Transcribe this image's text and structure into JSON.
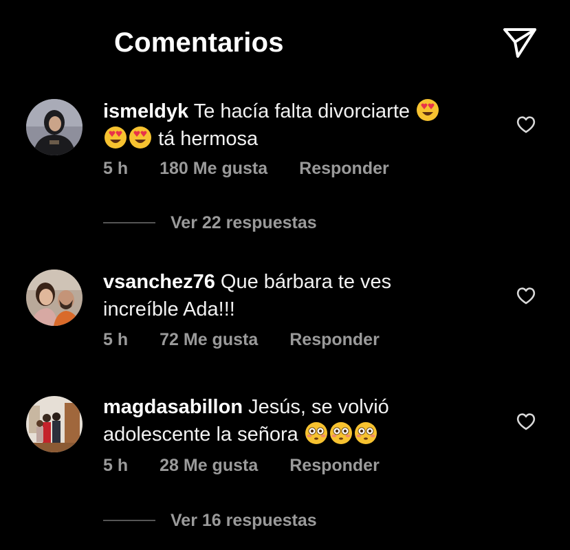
{
  "header": {
    "title": "Comentarios",
    "share_icon": "paper-plane-icon"
  },
  "comments": [
    {
      "username": "ismeldyk",
      "text_line1": "Te hacía falta divorciarte",
      "text_line2": "tá hermosa",
      "emoji": "heart-eyes-emoji",
      "emoji_count": 3,
      "time": "5 h",
      "likes": "180 Me gusta",
      "reply_label": "Responder",
      "view_replies": "Ver 22 respuestas"
    },
    {
      "username": "vsanchez76",
      "text_line1": "Que bárbara te ves",
      "text_line2": "increíble Ada!!!",
      "time": "5 h",
      "likes": "72 Me gusta",
      "reply_label": "Responder"
    },
    {
      "username": "magdasabillon",
      "text_line1": "Jesús, se volvió",
      "text_line2": "adolescente la señora",
      "emoji": "flushed-face-emoji",
      "emoji_count": 3,
      "time": "5 h",
      "likes": "28 Me gusta",
      "reply_label": "Responder",
      "view_replies": "Ver 16 respuestas"
    }
  ],
  "colors": {
    "background": "#000000",
    "text": "#f2f2f2",
    "muted": "#9a9a9a",
    "emoji_yellow": "#f7c230",
    "heart_eye_red": "#e8334a"
  }
}
